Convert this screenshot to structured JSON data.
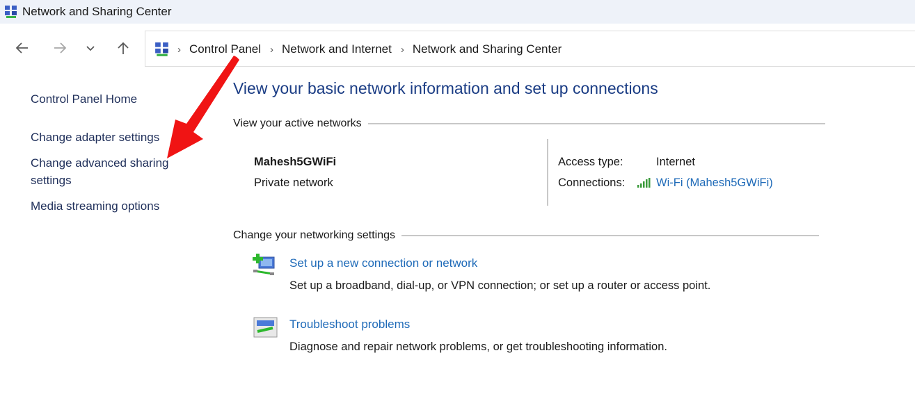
{
  "window": {
    "title": "Network and Sharing Center",
    "icon": "network-sharing-icon"
  },
  "nav": {
    "back_icon": "arrow-left-icon",
    "forward_icon": "arrow-right-icon",
    "recent_icon": "chevron-down-icon",
    "up_icon": "arrow-up-icon"
  },
  "address_bar": {
    "icon": "control-panel-icon",
    "breadcrumbs": [
      "Control Panel",
      "Network and Internet",
      "Network and Sharing Center"
    ],
    "separator": "›"
  },
  "sidebar": {
    "items": [
      {
        "label": "Control Panel Home"
      },
      {
        "label": "Change adapter settings"
      },
      {
        "label": "Change advanced sharing settings"
      },
      {
        "label": "Media streaming options"
      }
    ]
  },
  "main": {
    "title": "View your basic network information and set up connections",
    "active_networks": {
      "header": "View your active networks",
      "network_name": "Mahesh5GWiFi",
      "network_type": "Private network",
      "access_type_label": "Access type:",
      "access_type_value": "Internet",
      "connections_label": "Connections:",
      "connections_value": "Wi-Fi (Mahesh5GWiFi)",
      "connections_icon": "wifi-signal-icon"
    },
    "change_settings": {
      "header": "Change your networking settings",
      "tasks": [
        {
          "icon": "new-connection-icon",
          "link": "Set up a new connection or network",
          "description": "Set up a broadband, dial-up, or VPN connection; or set up a router or access point."
        },
        {
          "icon": "troubleshoot-icon",
          "link": "Troubleshoot problems",
          "description": "Diagnose and repair network problems, or get troubleshooting information."
        }
      ]
    }
  },
  "annotation": {
    "type": "red-arrow",
    "points_to": "Change advanced sharing settings",
    "color": "#f01414"
  }
}
